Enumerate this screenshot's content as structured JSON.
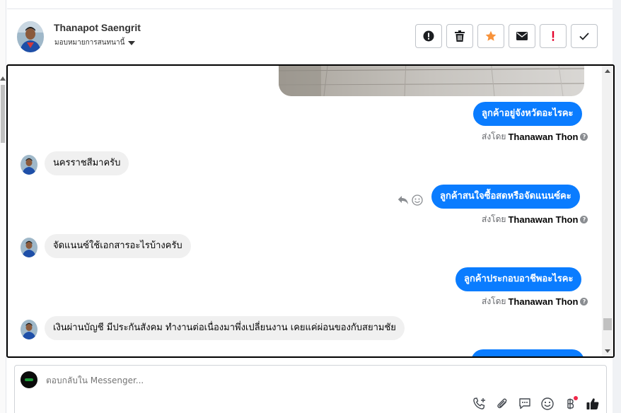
{
  "contact": {
    "name": "Thanapot Saengrit",
    "assign_label": "มอบหมายการสนทนานี้"
  },
  "actions": [
    {
      "icon": "alert-circle-icon"
    },
    {
      "icon": "trash-icon"
    },
    {
      "icon": "star-icon",
      "color": "#f7923a"
    },
    {
      "icon": "envelope-icon"
    },
    {
      "icon": "exclamation-icon",
      "color": "#e4002b"
    },
    {
      "icon": "checkmark-icon"
    }
  ],
  "messages": {
    "out1": "ลูกค้าอยู่จังหวัดอะไรคะ",
    "in1": "นครราชสีมาครับ",
    "out2": "ลูกค้าสนใจซื้อสดหรือจัดแนนซ์คะ",
    "in2": "จัดแนนซ์ใช้เอกสารอะไรบ้างครับ",
    "out3": "ลูกค้าประกอบอาชีพอะไรคะ",
    "in3": "เงินผ่านบัญชี มีประกันสังคม ทำงานต่อเนื่องมาพึ่งเปลี่ยนงาน เคยแค่ผ่อนของกับสยามชัย"
  },
  "sent_by": {
    "prefix": "ส่งโดย",
    "agent": "Thanawan Thon",
    "info_glyph": "?"
  },
  "composer": {
    "placeholder": "ตอบกลับใน Messenger..."
  },
  "tools": [
    "phone-add-icon",
    "paperclip-icon",
    "saved-reply-icon",
    "emoji-icon",
    "baht-icon",
    "thumbs-up-icon"
  ],
  "colors": {
    "accent": "#0a7cff",
    "incoming_bubble": "#f0f0f0"
  }
}
